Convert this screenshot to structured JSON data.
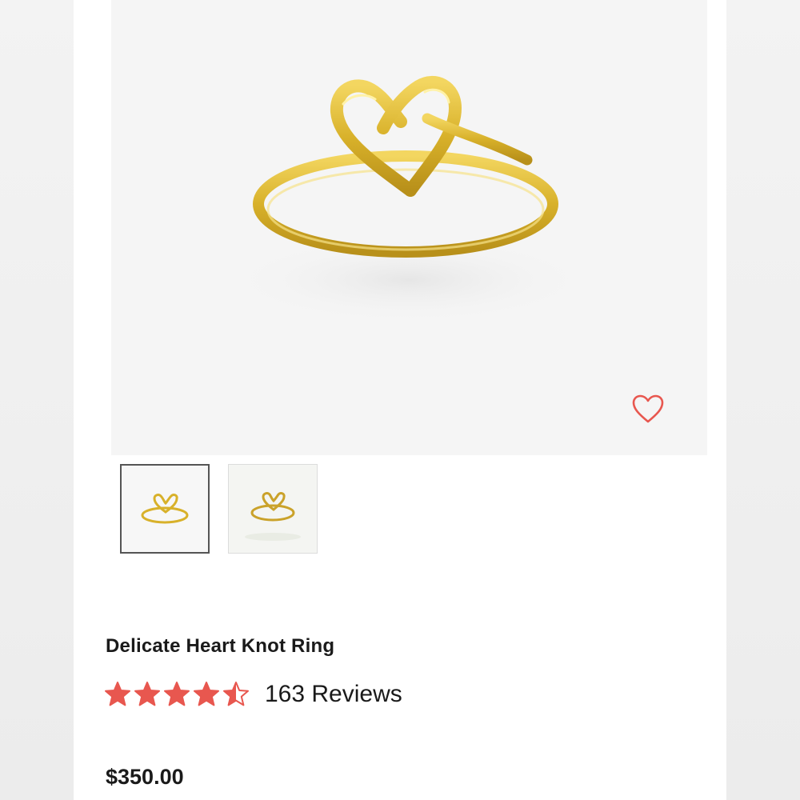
{
  "product": {
    "title": "Delicate Heart Knot Ring",
    "rating": 4.5,
    "rating_max": 5,
    "reviews_label": "163 Reviews",
    "price": "$350.00",
    "image_alt": "gold-heart-knot-ring"
  },
  "gallery": {
    "thumbnails": [
      "ring-front-view",
      "ring-angled-view"
    ],
    "selected_index": 0
  },
  "icons": {
    "wishlist": "heart-outline-icon",
    "star": "star-icon"
  },
  "colors": {
    "accent": "#e8574f",
    "gold": "#d9b52c",
    "text": "#1a1a1a"
  }
}
